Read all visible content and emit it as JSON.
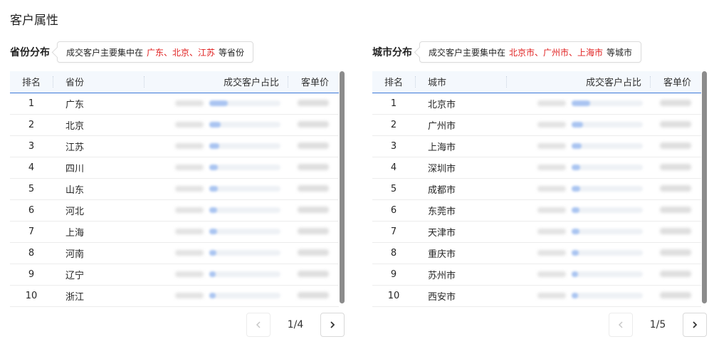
{
  "page": {
    "title": "客户属性"
  },
  "left": {
    "title": "省份分布",
    "tip_prefix": "成交客户主要集中在",
    "tip_highlight": "广东、北京、江苏",
    "tip_suffix": "等省份",
    "columns": {
      "rank": "排名",
      "name": "省份",
      "share": "成交客户占比",
      "price": "客单价"
    },
    "rows": [
      {
        "rank": "1",
        "name": "广东"
      },
      {
        "rank": "2",
        "name": "北京"
      },
      {
        "rank": "3",
        "name": "江苏"
      },
      {
        "rank": "4",
        "name": "四川"
      },
      {
        "rank": "5",
        "name": "山东"
      },
      {
        "rank": "6",
        "name": "河北"
      },
      {
        "rank": "7",
        "name": "上海"
      },
      {
        "rank": "8",
        "name": "河南"
      },
      {
        "rank": "9",
        "name": "辽宁"
      },
      {
        "rank": "10",
        "name": "浙江"
      }
    ],
    "pager": {
      "text": "1/4"
    }
  },
  "right": {
    "title": "城市分布",
    "tip_prefix": "成交客户主要集中在",
    "tip_highlight": "北京市、广州市、上海市",
    "tip_suffix": "等城市",
    "columns": {
      "rank": "排名",
      "name": "城市",
      "share": "成交客户占比",
      "price": "客单价"
    },
    "rows": [
      {
        "rank": "1",
        "name": "北京市"
      },
      {
        "rank": "2",
        "name": "广州市"
      },
      {
        "rank": "3",
        "name": "上海市"
      },
      {
        "rank": "4",
        "name": "深圳市"
      },
      {
        "rank": "5",
        "name": "成都市"
      },
      {
        "rank": "6",
        "name": "东莞市"
      },
      {
        "rank": "7",
        "name": "天津市"
      },
      {
        "rank": "8",
        "name": "重庆市"
      },
      {
        "rank": "9",
        "name": "苏州市"
      },
      {
        "rank": "10",
        "name": "西安市"
      }
    ],
    "pager": {
      "text": "1/5"
    }
  },
  "colors": {
    "highlight": "#e02020",
    "header_line": "#3a78d8",
    "bar": "#a9c4f1"
  },
  "icons": {
    "prev": "chevron-left-icon",
    "next": "chevron-right-icon"
  }
}
